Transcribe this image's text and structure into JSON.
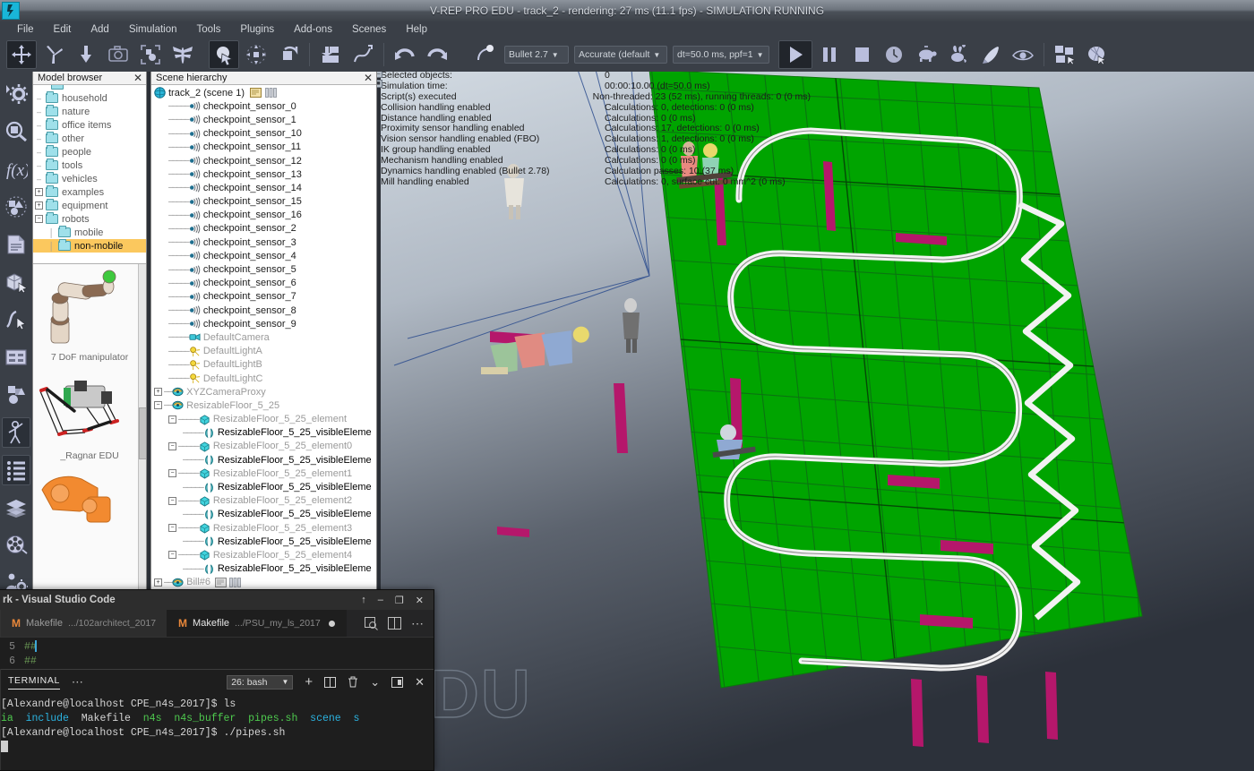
{
  "app": {
    "title": "V-REP PRO EDU - track_2 - rendering: 27 ms (11.1 fps) - SIMULATION RUNNING",
    "logo_glyph": "∴",
    "watermark": "DU"
  },
  "menu": {
    "items": [
      {
        "label": "File",
        "name": "menu-file"
      },
      {
        "label": "Edit",
        "name": "menu-edit"
      },
      {
        "label": "Add",
        "name": "menu-add"
      },
      {
        "label": "Simulation",
        "name": "menu-simulation"
      },
      {
        "label": "Tools",
        "name": "menu-tools"
      },
      {
        "label": "Plugins",
        "name": "menu-plugins"
      },
      {
        "label": "Add-ons",
        "name": "menu-addons"
      },
      {
        "label": "Scenes",
        "name": "menu-scenes"
      },
      {
        "label": "Help",
        "name": "menu-help"
      }
    ]
  },
  "toolbar": {
    "icons": [
      {
        "name": "object-shift-icon",
        "active": true
      },
      {
        "name": "object-rotate-icon",
        "active": false
      },
      {
        "name": "object-drop-icon",
        "active": false
      },
      {
        "name": "camera-icon",
        "active": false
      },
      {
        "name": "bounding-box-icon",
        "active": false
      },
      {
        "name": "dragonfly-icon",
        "active": false
      },
      {
        "name": "object-select-icon",
        "active": true
      },
      {
        "name": "page-select-icon",
        "active": false
      },
      {
        "name": "rotate-view-icon",
        "active": false
      },
      {
        "name": "assemble-icon",
        "active": false
      },
      {
        "name": "path-edit-icon",
        "active": false
      },
      {
        "name": "undo-icon",
        "active": false
      },
      {
        "name": "redo-icon",
        "active": false
      },
      {
        "name": "transfer-icon",
        "active": false
      }
    ],
    "engine": "Bullet 2.7",
    "engine_caret": "▼",
    "precision": "Accurate (default",
    "precision_caret": "▼",
    "timestep": "dt=50.0 ms, ppf=1",
    "timestep_caret": "▼",
    "sim_controls": [
      {
        "name": "start-simulation-button",
        "label": "play",
        "active": true
      },
      {
        "name": "pause-simulation-button",
        "label": "pause",
        "active": false
      },
      {
        "name": "stop-simulation-button",
        "label": "stop",
        "active": false
      },
      {
        "name": "realtime-clock-icon",
        "label": "clock",
        "active": false
      },
      {
        "name": "slow-down-turtle-icon",
        "label": "turtle",
        "active": false
      },
      {
        "name": "speed-up-rabbit-icon",
        "label": "rabbit",
        "active": false
      },
      {
        "name": "fast-rocket-icon",
        "label": "rocket",
        "active": false
      },
      {
        "name": "visualize-eye-icon",
        "label": "eye",
        "active": false
      },
      {
        "name": "page-selector-icon",
        "label": "pages",
        "active": false
      },
      {
        "name": "view-selector-icon",
        "label": "views",
        "active": false
      }
    ]
  },
  "vtoolbar": {
    "items": [
      {
        "name": "scene-object-properties-icon",
        "active": false
      },
      {
        "name": "calculation-modules-icon",
        "active": false
      },
      {
        "name": "user-parameters-fx-icon",
        "active": false
      },
      {
        "name": "object-shape-dlg-icon",
        "active": false
      },
      {
        "name": "script-editor-icon",
        "active": false
      },
      {
        "name": "shape-edit-mode-icon",
        "active": false
      },
      {
        "name": "path-edit-mode-icon",
        "active": false
      },
      {
        "name": "custom-ui-icon",
        "active": false
      },
      {
        "name": "model-collection-icon",
        "active": false
      },
      {
        "name": "bill-human-icon",
        "active": true
      },
      {
        "name": "scene-hierarchy-toggle-icon",
        "active": true
      },
      {
        "name": "layers-icon",
        "active": false
      },
      {
        "name": "video-recorder-icon",
        "active": false
      },
      {
        "name": "user-settings-icon",
        "active": false
      }
    ]
  },
  "model_browser": {
    "title": "Model browser",
    "close_glyph": "✕",
    "tree": [
      {
        "label": "household",
        "expander": "",
        "depth": 0,
        "selected": false
      },
      {
        "label": "nature",
        "expander": "",
        "depth": 0,
        "selected": false
      },
      {
        "label": "office items",
        "expander": "",
        "depth": 0,
        "selected": false
      },
      {
        "label": "other",
        "expander": "",
        "depth": 0,
        "selected": false
      },
      {
        "label": "people",
        "expander": "",
        "depth": 0,
        "selected": false
      },
      {
        "label": "tools",
        "expander": "",
        "depth": 0,
        "selected": false
      },
      {
        "label": "vehicles",
        "expander": "",
        "depth": 0,
        "selected": false
      },
      {
        "label": "examples",
        "expander": "+",
        "depth": 0,
        "selected": false
      },
      {
        "label": "equipment",
        "expander": "+",
        "depth": 0,
        "selected": false
      },
      {
        "label": "robots",
        "expander": "−",
        "depth": 0,
        "selected": false
      },
      {
        "label": "mobile",
        "expander": "",
        "depth": 1,
        "selected": false
      },
      {
        "label": "non-mobile",
        "expander": "",
        "depth": 1,
        "selected": true
      }
    ],
    "models": [
      {
        "label": "7 DoF manipulator",
        "name": "model-7dof-manipulator"
      },
      {
        "label": "_Ragnar EDU",
        "name": "model-ragnar-edu"
      },
      {
        "label": "",
        "name": "model-orange-robot"
      }
    ]
  },
  "scene_hierarchy": {
    "title": "Scene hierarchy",
    "close_glyph": "✕",
    "root": {
      "label": "track_2 (scene 1)",
      "icon": "world-icon"
    },
    "nodes": [
      {
        "label": "checkpoint_sensor_0",
        "icon": "proximity-sensor-icon",
        "depth": 1,
        "style": "dark",
        "expander": ""
      },
      {
        "label": "checkpoint_sensor_1",
        "icon": "proximity-sensor-icon",
        "depth": 1,
        "style": "dark",
        "expander": ""
      },
      {
        "label": "checkpoint_sensor_10",
        "icon": "proximity-sensor-icon",
        "depth": 1,
        "style": "dark",
        "expander": ""
      },
      {
        "label": "checkpoint_sensor_11",
        "icon": "proximity-sensor-icon",
        "depth": 1,
        "style": "dark",
        "expander": ""
      },
      {
        "label": "checkpoint_sensor_12",
        "icon": "proximity-sensor-icon",
        "depth": 1,
        "style": "dark",
        "expander": ""
      },
      {
        "label": "checkpoint_sensor_13",
        "icon": "proximity-sensor-icon",
        "depth": 1,
        "style": "dark",
        "expander": ""
      },
      {
        "label": "checkpoint_sensor_14",
        "icon": "proximity-sensor-icon",
        "depth": 1,
        "style": "dark",
        "expander": ""
      },
      {
        "label": "checkpoint_sensor_15",
        "icon": "proximity-sensor-icon",
        "depth": 1,
        "style": "dark",
        "expander": ""
      },
      {
        "label": "checkpoint_sensor_16",
        "icon": "proximity-sensor-icon",
        "depth": 1,
        "style": "dark",
        "expander": ""
      },
      {
        "label": "checkpoint_sensor_2",
        "icon": "proximity-sensor-icon",
        "depth": 1,
        "style": "dark",
        "expander": ""
      },
      {
        "label": "checkpoint_sensor_3",
        "icon": "proximity-sensor-icon",
        "depth": 1,
        "style": "dark",
        "expander": ""
      },
      {
        "label": "checkpoint_sensor_4",
        "icon": "proximity-sensor-icon",
        "depth": 1,
        "style": "dark",
        "expander": ""
      },
      {
        "label": "checkpoint_sensor_5",
        "icon": "proximity-sensor-icon",
        "depth": 1,
        "style": "dark",
        "expander": ""
      },
      {
        "label": "checkpoint_sensor_6",
        "icon": "proximity-sensor-icon",
        "depth": 1,
        "style": "dark",
        "expander": ""
      },
      {
        "label": "checkpoint_sensor_7",
        "icon": "proximity-sensor-icon",
        "depth": 1,
        "style": "dark",
        "expander": ""
      },
      {
        "label": "checkpoint_sensor_8",
        "icon": "proximity-sensor-icon",
        "depth": 1,
        "style": "dark",
        "expander": ""
      },
      {
        "label": "checkpoint_sensor_9",
        "icon": "proximity-sensor-icon",
        "depth": 1,
        "style": "dark",
        "expander": ""
      },
      {
        "label": "DefaultCamera",
        "icon": "camera-icon",
        "depth": 1,
        "style": "grey",
        "expander": ""
      },
      {
        "label": "DefaultLightA",
        "icon": "light-icon",
        "depth": 1,
        "style": "grey",
        "expander": ""
      },
      {
        "label": "DefaultLightB",
        "icon": "light-icon",
        "depth": 1,
        "style": "grey",
        "expander": ""
      },
      {
        "label": "DefaultLightC",
        "icon": "light-icon",
        "depth": 1,
        "style": "grey",
        "expander": ""
      },
      {
        "label": "XYZCameraProxy",
        "icon": "dummy-icon",
        "depth": 0,
        "style": "grey",
        "expander": "+"
      },
      {
        "label": "ResizableFloor_5_25",
        "icon": "dummy-icon",
        "depth": 0,
        "style": "grey",
        "expander": "−"
      },
      {
        "label": "ResizableFloor_5_25_element",
        "icon": "shape-icon",
        "depth": 1,
        "style": "grey",
        "expander": "−"
      },
      {
        "label": "ResizableFloor_5_25_visibleEleme",
        "icon": "mesh-icon",
        "depth": 2,
        "style": "black",
        "expander": ""
      },
      {
        "label": "ResizableFloor_5_25_element0",
        "icon": "shape-icon",
        "depth": 1,
        "style": "grey",
        "expander": "−"
      },
      {
        "label": "ResizableFloor_5_25_visibleEleme",
        "icon": "mesh-icon",
        "depth": 2,
        "style": "black",
        "expander": ""
      },
      {
        "label": "ResizableFloor_5_25_element1",
        "icon": "shape-icon",
        "depth": 1,
        "style": "grey",
        "expander": "−"
      },
      {
        "label": "ResizableFloor_5_25_visibleEleme",
        "icon": "mesh-icon",
        "depth": 2,
        "style": "black",
        "expander": ""
      },
      {
        "label": "ResizableFloor_5_25_element2",
        "icon": "shape-icon",
        "depth": 1,
        "style": "grey",
        "expander": "−"
      },
      {
        "label": "ResizableFloor_5_25_visibleEleme",
        "icon": "mesh-icon",
        "depth": 2,
        "style": "black",
        "expander": ""
      },
      {
        "label": "ResizableFloor_5_25_element3",
        "icon": "shape-icon",
        "depth": 1,
        "style": "grey",
        "expander": "−"
      },
      {
        "label": "ResizableFloor_5_25_visibleEleme",
        "icon": "mesh-icon",
        "depth": 2,
        "style": "black",
        "expander": ""
      },
      {
        "label": "ResizableFloor_5_25_element4",
        "icon": "shape-icon",
        "depth": 1,
        "style": "grey",
        "expander": "−"
      },
      {
        "label": "ResizableFloor_5_25_visibleEleme",
        "icon": "mesh-icon",
        "depth": 2,
        "style": "black",
        "expander": ""
      },
      {
        "label": "Bill#6",
        "icon": "dummy-icon",
        "depth": 0,
        "style": "grey",
        "expander": "+"
      }
    ]
  },
  "status_panel": {
    "rows": [
      {
        "label": "Selected objects:",
        "value": "0"
      },
      {
        "label": "Simulation time:",
        "value": "00:00:10.00 (dt=50.0 ms)"
      },
      {
        "label": "Script(s) executed",
        "value": "Non-threaded: 23 (52 ms), running threads: 0 (0 ms)"
      },
      {
        "label": "Collision handling enabled",
        "value": "Calculations: 0, detections: 0 (0 ms)"
      },
      {
        "label": "Distance handling enabled",
        "value": "Calculations: 0 (0 ms)"
      },
      {
        "label": "Proximity sensor handling enabled",
        "value": "Calculations: 17, detections: 0 (0 ms)"
      },
      {
        "label": "Vision sensor handling enabled (FBO)",
        "value": "Calculations: 1, detections: 0 (0 ms)"
      },
      {
        "label": "IK group handling enabled",
        "value": "Calculations: 0 (0 ms)"
      },
      {
        "label": "Mechanism handling enabled",
        "value": "Calculations: 0 (0 ms)"
      },
      {
        "label": "Dynamics handling enabled (Bullet 2.78)",
        "value": "Calculation passes: 10 (37 ms)"
      },
      {
        "label": "Mill handling enabled",
        "value": "Calculations: 0, surface cut: 0 mm^2 (0 ms)"
      }
    ]
  },
  "vscode": {
    "title": "rk - Visual Studio Code",
    "window_buttons": [
      {
        "glyph": "↑",
        "name": "restore-up-button"
      },
      {
        "glyph": "–",
        "name": "minimize-button"
      },
      {
        "glyph": "❐",
        "name": "maximize-button"
      },
      {
        "glyph": "✕",
        "name": "close-button"
      }
    ],
    "tabs": [
      {
        "icon": "M",
        "label": "Makefile",
        "sub": ".../102architect_2017",
        "active": false,
        "dirty": false
      },
      {
        "icon": "M",
        "label": "Makefile",
        "sub": ".../PSU_my_ls_2017",
        "active": true,
        "dirty": true
      }
    ],
    "tab_actions": [
      {
        "glyph": "⌕",
        "name": "split-preview-icon"
      },
      {
        "glyph": "▥",
        "name": "split-editor-icon"
      },
      {
        "glyph": "⋯",
        "name": "more-actions-icon"
      }
    ],
    "editor_lines": [
      {
        "num": "5",
        "text": "##"
      },
      {
        "num": "6",
        "text": "##"
      }
    ],
    "panel": {
      "tab_label": "TERMINAL",
      "more_glyph": "⋯",
      "select_value": "26: bash",
      "select_caret": "▼",
      "icons": [
        {
          "glyph": "+",
          "name": "new-terminal-icon"
        },
        {
          "glyph": "▥",
          "name": "split-terminal-icon"
        },
        {
          "glyph": "Ὕ1",
          "name": "kill-terminal-icon"
        },
        {
          "glyph": "⌄",
          "name": "chevron-down-icon"
        },
        {
          "glyph": "▣",
          "name": "maximize-panel-icon"
        },
        {
          "glyph": "✕",
          "name": "close-panel-icon"
        }
      ]
    },
    "terminal": {
      "lines": [
        {
          "prompt": "[Alexandre@localhost CPE_n4s_2017]$",
          "command": " ls",
          "type": "prompt"
        },
        {
          "type": "listing",
          "items": [
            "ia",
            "include",
            "Makefile",
            "n4s",
            "n4s_buffer",
            "pipes.sh",
            "scene",
            "s"
          ],
          "colors": [
            "green",
            "dir",
            "plain",
            "green",
            "green",
            "green",
            "dir",
            "dir"
          ]
        },
        {
          "prompt": "[Alexandre@localhost CPE_n4s_2017]$",
          "command": " ./pipes.sh",
          "type": "prompt"
        }
      ],
      "cursor": true
    }
  },
  "colors": {
    "accent_orange": "#e8873a",
    "selection_yellow": "#fbc85e",
    "floor_green": "#00a400",
    "track_white": "#e8e8e8",
    "checkpoint_magenta": "#b5176b",
    "vrep_panel": "#3a3f47",
    "vscode_bg": "#1e1e1e"
  }
}
